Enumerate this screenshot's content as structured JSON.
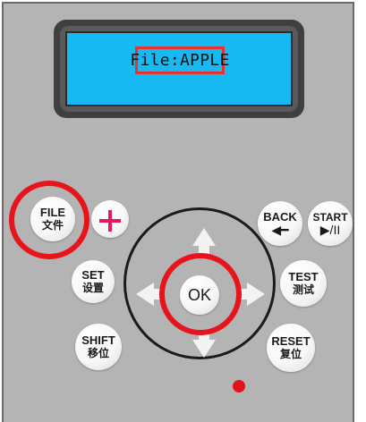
{
  "display": {
    "text": "File:APPLE"
  },
  "buttons": {
    "file": {
      "en": "FILE",
      "cn": "文件"
    },
    "back": {
      "en": "BACK",
      "glyph": "◀━"
    },
    "start": {
      "en": "START",
      "glyph": "▶/II"
    },
    "set": {
      "en": "SET",
      "cn": "设置"
    },
    "test": {
      "en": "TEST",
      "cn": "测试"
    },
    "ok": {
      "en": "OK"
    },
    "shift": {
      "en": "SHIFT",
      "cn": "移位"
    },
    "reset": {
      "en": "RESET",
      "cn": "复位"
    },
    "plus": {
      "symbol": "+"
    }
  },
  "colors": {
    "panel": "#b4b4b4",
    "lcd": "#17b9f2",
    "highlight": "#e8141b",
    "plus": "#e5185c",
    "led": "#e0141a"
  }
}
